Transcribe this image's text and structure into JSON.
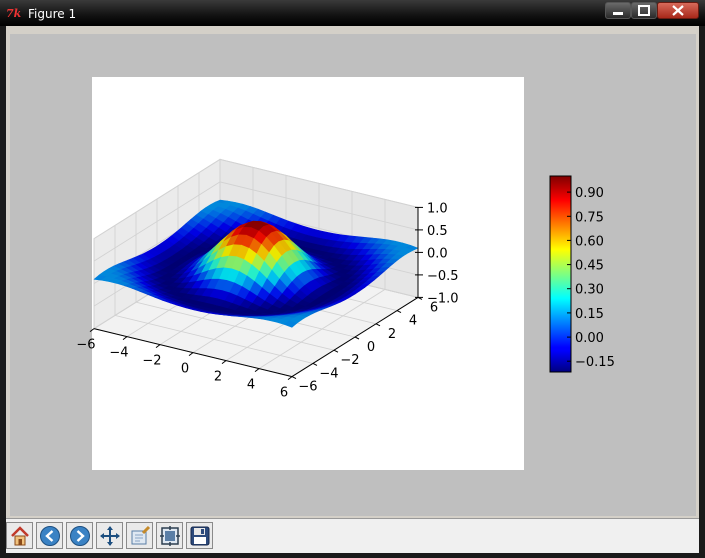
{
  "window": {
    "title": "Figure 1",
    "app_icon": "tk-feather-icon",
    "logo_text": "7k"
  },
  "window_controls": [
    "minimize",
    "maximize",
    "close"
  ],
  "toolbar": {
    "buttons": [
      {
        "name": "home-button",
        "icon": "home-icon"
      },
      {
        "name": "back-button",
        "icon": "arrow-left-icon"
      },
      {
        "name": "forward-button",
        "icon": "arrow-right-icon"
      },
      {
        "name": "pan-button",
        "icon": "move-icon"
      },
      {
        "name": "zoom-button",
        "icon": "zoom-rect-icon"
      },
      {
        "name": "subplots-button",
        "icon": "subplots-icon"
      },
      {
        "name": "save-button",
        "icon": "floppy-disk-icon"
      }
    ]
  },
  "colors": {
    "figure_bg": "#bfbfbf",
    "axes_bg": "#ffffff",
    "colormap": "jet"
  },
  "chart_data": {
    "type": "surface",
    "function": "sin(R)/R, R = sqrt(X^2 + Y^2)",
    "title": "",
    "xlabel": "",
    "ylabel": "",
    "zlabel": "",
    "xlim": [
      -6,
      6
    ],
    "ylim": [
      -6,
      6
    ],
    "zlim": [
      -1.0,
      1.0
    ],
    "x_ticks": [
      "−6",
      "−4",
      "−2",
      "0",
      "2",
      "4",
      "6"
    ],
    "y_ticks": [
      "−6",
      "−4",
      "−2",
      "0",
      "2",
      "4",
      "6"
    ],
    "z_ticks": [
      "−1.0",
      "−0.5",
      "0.0",
      "0.5",
      "1.0"
    ],
    "z_max": 1.0,
    "z_min": -0.22,
    "grid": true,
    "colorbar": {
      "ticks": [
        "0.90",
        "0.75",
        "0.60",
        "0.45",
        "0.30",
        "0.15",
        "0.00",
        "−0.15"
      ],
      "tick_values": [
        0.9,
        0.75,
        0.6,
        0.45,
        0.3,
        0.15,
        0.0,
        -0.15
      ],
      "vmin": -0.217,
      "vmax": 1.0
    }
  }
}
